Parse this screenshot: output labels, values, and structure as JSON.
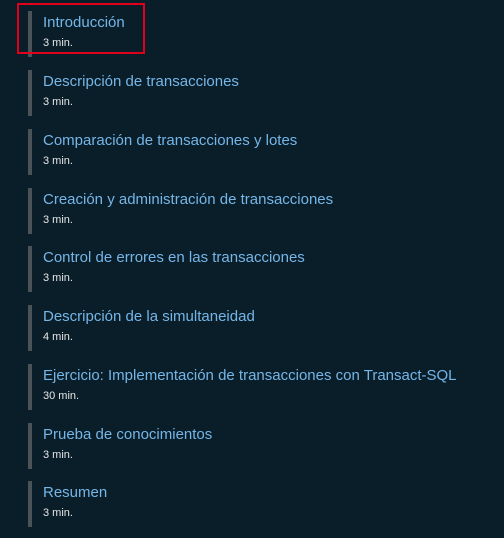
{
  "module": {
    "units": [
      {
        "title": "Introducción",
        "duration": "3 min."
      },
      {
        "title": "Descripción de transacciones",
        "duration": "3 min."
      },
      {
        "title": "Comparación de transacciones y lotes",
        "duration": "3 min."
      },
      {
        "title": "Creación y administración de transacciones",
        "duration": "3 min."
      },
      {
        "title": "Control de errores en las transacciones",
        "duration": "3 min."
      },
      {
        "title": "Descripción de la simultaneidad",
        "duration": "4 min."
      },
      {
        "title": "Ejercicio: Implementación de transacciones con Transact-SQL",
        "duration": "30 min."
      },
      {
        "title": "Prueba de conocimientos",
        "duration": "3 min."
      },
      {
        "title": "Resumen",
        "duration": "3 min."
      }
    ],
    "highlight_color": "#e0001b",
    "link_color": "#75b6e7",
    "background_color": "#0a1e2a"
  }
}
